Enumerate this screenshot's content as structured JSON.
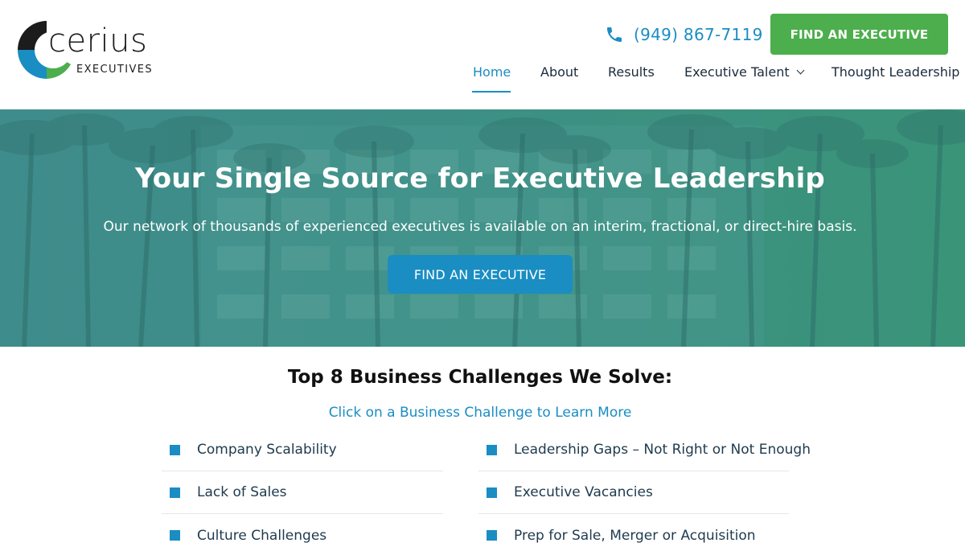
{
  "brand": {
    "name": "cerius",
    "tagline": "EXECUTIVES",
    "colors": {
      "blue": "#1a8dc3",
      "green": "#4cae4c",
      "dark": "#1c1c1c"
    }
  },
  "header": {
    "phone": "(949) 867-7119",
    "cta": "FIND AN EXECUTIVE"
  },
  "nav": {
    "items": [
      {
        "label": "Home",
        "active": true
      },
      {
        "label": "About"
      },
      {
        "label": "Results"
      },
      {
        "label": "Executive Talent",
        "has_dropdown": true
      },
      {
        "label": "Thought Leadership"
      }
    ]
  },
  "hero": {
    "title": "Your Single Source for Executive Leadership",
    "subtitle": "Our network of thousands of experienced executives is available on an interim, fractional, or direct-hire basis.",
    "button": "FIND AN EXECUTIVE"
  },
  "challenges": {
    "title": "Top 8 Business Challenges We Solve:",
    "subtitle": "Click on a Business Challenge to Learn More",
    "left": [
      "Company Scalability",
      "Lack of Sales",
      "Culture Challenges"
    ],
    "right": [
      "Leadership Gaps – Not Right or Not Enough",
      "Executive Vacancies",
      "Prep for Sale, Merger or Acquisition"
    ]
  }
}
